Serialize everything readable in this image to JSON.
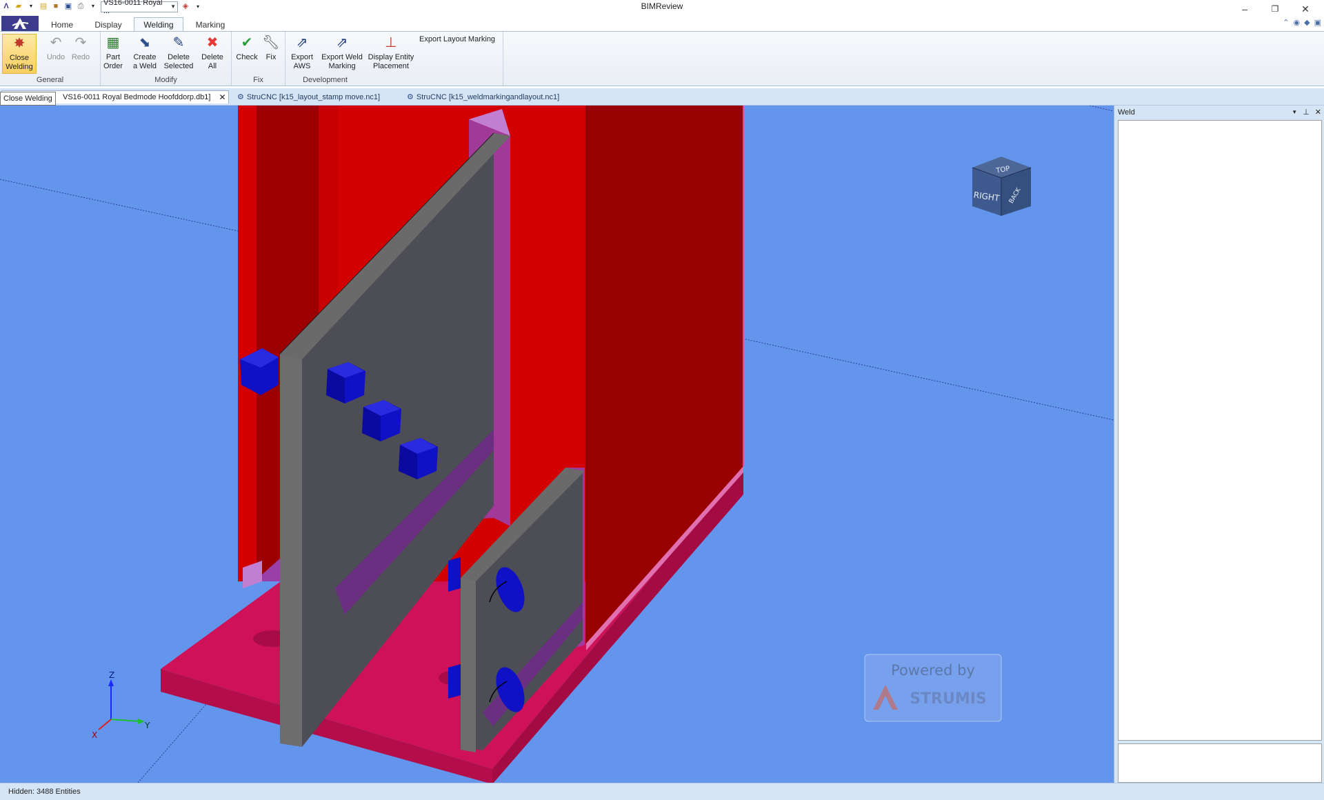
{
  "titlebar": {
    "app_title": "BIMReview",
    "document_select": "VS16-0011 Royal ...",
    "window_controls": {
      "minimize": "–",
      "restore": "❐",
      "close": "✕"
    }
  },
  "ribbon_tabs": [
    {
      "label": "Home"
    },
    {
      "label": "Display"
    },
    {
      "label": "Welding"
    },
    {
      "label": "Marking"
    }
  ],
  "ribbon": {
    "groups": {
      "general": "General",
      "modify": "Modify",
      "fix": "Fix",
      "development": "Development"
    },
    "buttons": {
      "close_welding": "Close\nWelding",
      "undo": "Undo",
      "redo": "Redo",
      "part_order": "Part\nOrder",
      "create_weld": "Create\na Weld",
      "delete_selected": "Delete\nSelected",
      "delete_all": "Delete\nAll",
      "check": "Check",
      "fix": "Fix",
      "export_aws": "Export\nAWS",
      "export_weld_marking": "Export Weld\nMarking",
      "display_entity_placement": "Display Entity\nPlacement",
      "export_layout_marking": "Export Layout Marking"
    }
  },
  "doc_tabs": [
    {
      "label": "VS16-0011 Royal Bedmode Hoofddorp.db1]",
      "close": "✕"
    },
    {
      "label": "StruCNC [k15_layout_stamp move.nc1]"
    },
    {
      "label": "StruCNC [k15_weldmarkingandlayout.nc1]"
    }
  ],
  "tooltip": "Close Welding",
  "viewcube": {
    "top": "TOP",
    "right": "RIGHT",
    "back": "BACK"
  },
  "axes": {
    "x": "X",
    "y": "Y",
    "z": "Z"
  },
  "watermark": {
    "line1": "Powered by",
    "line2": "STRUMIS"
  },
  "side_panel": {
    "title": "Weld"
  },
  "status": "Hidden: 3488 Entities",
  "colors": {
    "viewport_bg": "#6495ed",
    "column": "#cc0000",
    "base_plate": "#d6105a",
    "plate_gray": "#5a5a5a",
    "bolt": "#0a12cc"
  }
}
